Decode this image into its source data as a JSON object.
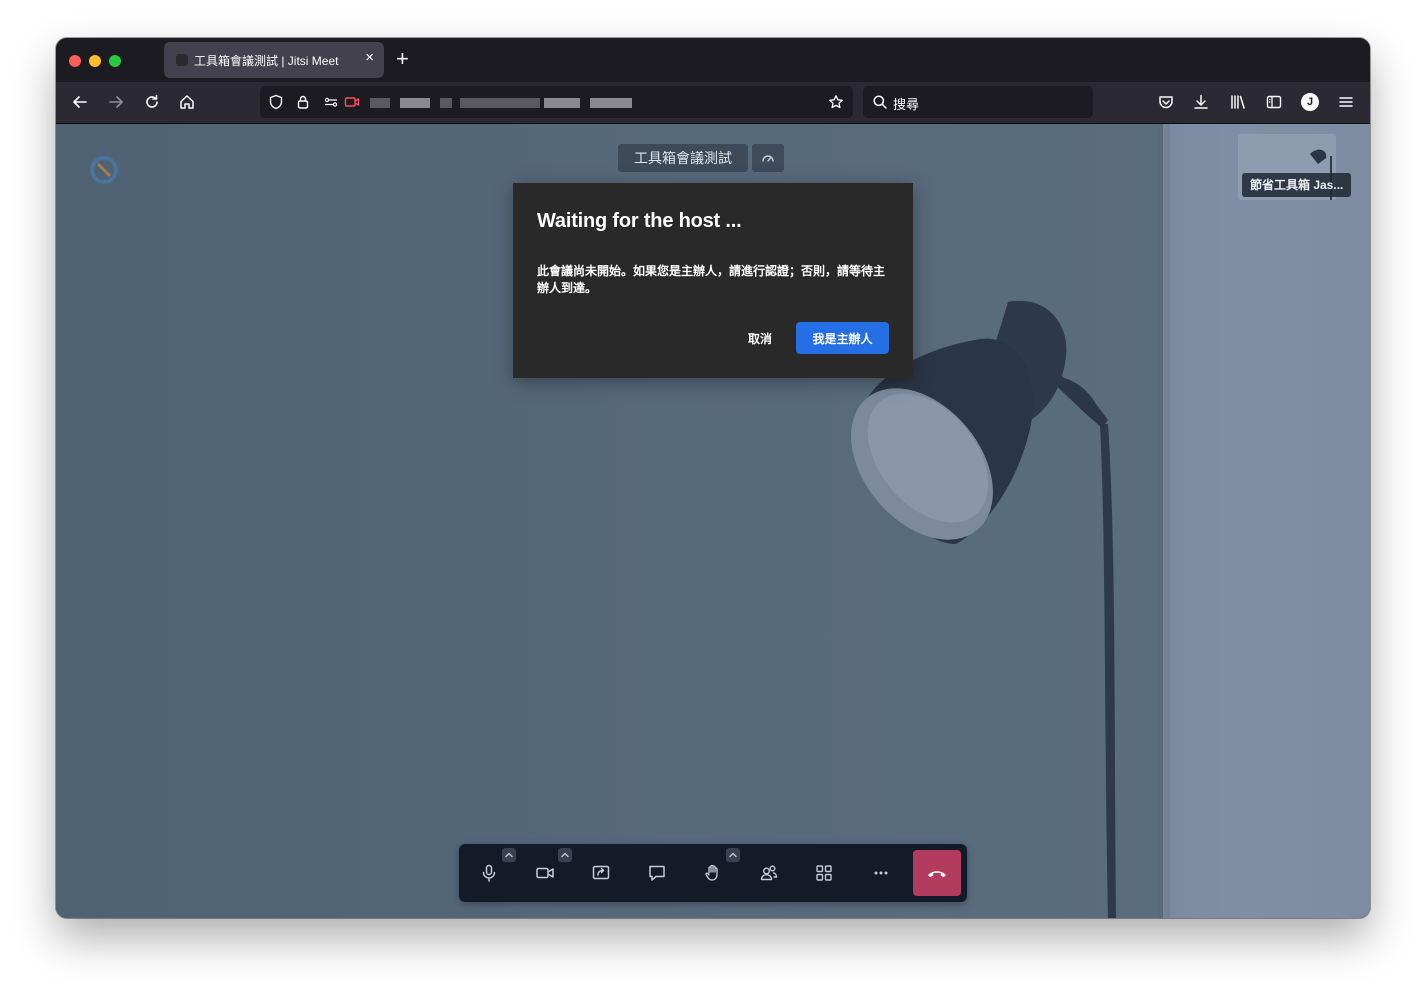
{
  "browser": {
    "tab_title": "工具箱會議測試 | Jitsi Meet",
    "tab_close": "×",
    "new_tab": "+",
    "search_placeholder": "搜尋",
    "account_initial": "J"
  },
  "meeting": {
    "title": "工具箱會議測試",
    "thumbnail_name": "節省工具箱 Jas..."
  },
  "dialog": {
    "title": "Waiting for the host ...",
    "body": "此會議尚未開始。如果您是主辦人，請進行認證；否則，請等待主辦人到達。",
    "cancel_label": "取消",
    "confirm_label": "我是主辦人"
  },
  "colors": {
    "primary_button": "#246fe5",
    "hangup": "#b23b5e",
    "dialog_bg": "#292929",
    "toolbar_bg": "#141b28"
  },
  "icons": {
    "toolbar": [
      "microphone-icon",
      "camera-icon",
      "screen-share-icon",
      "chat-icon",
      "raise-hand-icon",
      "participants-icon",
      "tile-view-icon",
      "more-icon",
      "hangup-icon"
    ]
  }
}
